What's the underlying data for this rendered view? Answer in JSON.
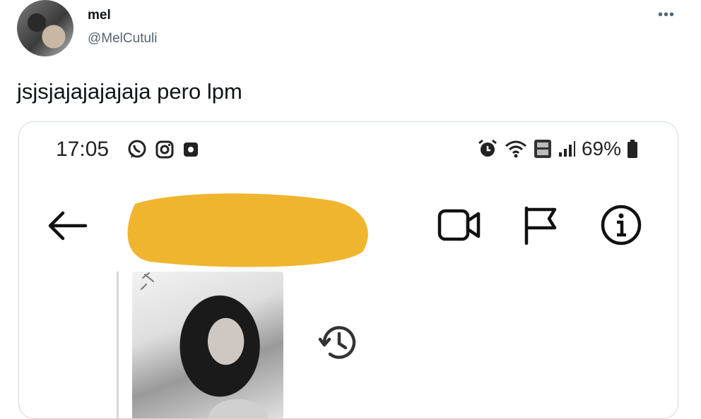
{
  "tweet": {
    "author_name": "mel",
    "author_handle": "@MelCutuli",
    "more_label": "•••",
    "text": "jsjsjajajajajaja pero lpm"
  },
  "phone_screenshot": {
    "status_bar": {
      "time": "17:05",
      "battery": "69%",
      "left_icons": [
        "whatsapp-icon",
        "instagram-icon",
        "notification-icon"
      ],
      "right_icons": [
        "alarm-icon",
        "wifi-icon",
        "volte-4g-icon",
        "signal-icon",
        "battery-icon"
      ]
    },
    "header": {
      "icons": [
        "back-arrow-icon",
        "video-call-icon",
        "flag-icon",
        "info-icon"
      ],
      "redaction_color": "#f0b52e"
    },
    "content": {
      "icons": [
        "pin-icon",
        "history-icon"
      ]
    }
  },
  "colors": {
    "handle": "#536471",
    "border": "#cfd9de",
    "redaction": "#f0b52e"
  }
}
